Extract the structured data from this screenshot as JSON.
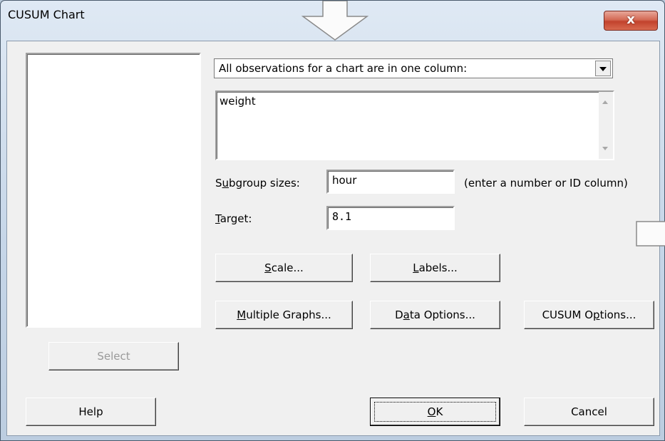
{
  "window": {
    "title": "CUSUM Chart",
    "close_glyph": "x"
  },
  "variable_list": {
    "items": []
  },
  "layout_select": {
    "value": "All observations for a chart are in one column:"
  },
  "columns_box": {
    "value": "weight"
  },
  "subgroup": {
    "label_pre": "S",
    "label_u": "u",
    "label_post": "bgroup sizes:",
    "value": "hour",
    "hint": "(enter a number or ID column)"
  },
  "target": {
    "label_u": "T",
    "label_post": "arget:",
    "value": "8.1"
  },
  "buttons": {
    "scale": {
      "u": "S",
      "rest": "cale..."
    },
    "labels": {
      "u": "L",
      "rest": "abels..."
    },
    "multiple_graphs": {
      "u": "M",
      "rest": "ultiple Graphs..."
    },
    "data_options": {
      "pre": "D",
      "u": "a",
      "rest": "ta Options..."
    },
    "cusum_options": {
      "pre": "CUSUM O",
      "u": "p",
      "rest": "tions..."
    },
    "select": "Select",
    "help": "Help",
    "ok": {
      "u": "O",
      "rest": "K"
    },
    "cancel": "Cancel"
  },
  "colors": {
    "dialog_bg": "#f0f0f0",
    "close_red": "#c2422c"
  },
  "icons": [
    "close-icon",
    "down-arrow-annotation-icon",
    "right-arrow-annotation-icon",
    "dropdown-chevron-icon",
    "scroll-up-icon",
    "scroll-down-icon"
  ]
}
